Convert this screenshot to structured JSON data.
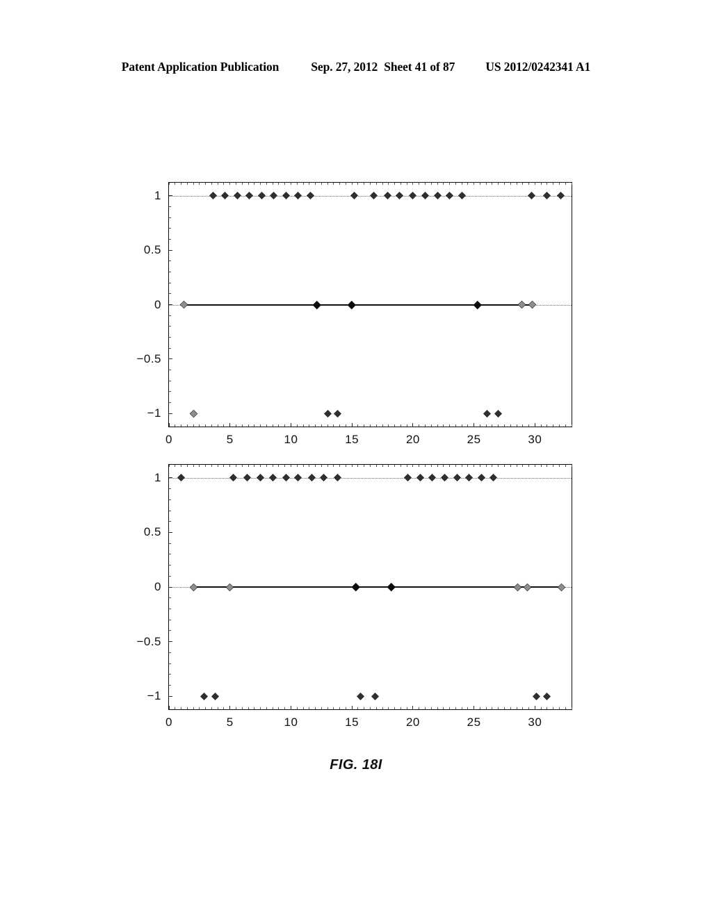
{
  "header": {
    "publication": "Patent Application Publication",
    "date": "Sep. 27, 2012",
    "sheet": "Sheet 41 of 87",
    "patent_number": "US 2012/0242341 A1"
  },
  "figure": {
    "caption": "FIG. 18I"
  },
  "axes": {
    "x_ticks": [
      "0",
      "5",
      "10",
      "15",
      "20",
      "25",
      "30"
    ],
    "y_ticks": [
      "1",
      "0.5",
      "0",
      "−0.5",
      "−1"
    ]
  },
  "colors": {
    "ink": "#0b0b0b",
    "marker": "#2f2f2f",
    "marker_open": "#8e8e8e",
    "grid": "#6b6b6b"
  },
  "chart_data": [
    {
      "type": "scatter",
      "id": "chart-1",
      "title": "",
      "xlabel": "",
      "ylabel": "",
      "xlim": [
        0,
        33
      ],
      "ylim": [
        -1.12,
        1.12
      ],
      "x_ticks": [
        0,
        5,
        10,
        15,
        20,
        25,
        30
      ],
      "y_ticks": [
        1,
        0.5,
        0,
        -0.5,
        -1
      ],
      "grid": true,
      "marker": "diamond",
      "series": [
        {
          "name": "signal-1",
          "points": [
            {
              "x": 1.2,
              "y": 0,
              "style": "open"
            },
            {
              "x": 2.0,
              "y": -1,
              "style": "open"
            },
            {
              "x": 3.6,
              "y": 1,
              "style": "filled"
            },
            {
              "x": 4.6,
              "y": 1,
              "style": "filled"
            },
            {
              "x": 5.6,
              "y": 1,
              "style": "filled"
            },
            {
              "x": 6.6,
              "y": 1,
              "style": "filled"
            },
            {
              "x": 7.6,
              "y": 1,
              "style": "filled"
            },
            {
              "x": 8.6,
              "y": 1,
              "style": "filled"
            },
            {
              "x": 9.6,
              "y": 1,
              "style": "filled"
            },
            {
              "x": 10.6,
              "y": 1,
              "style": "filled"
            },
            {
              "x": 11.6,
              "y": 1,
              "style": "filled"
            },
            {
              "x": 12.1,
              "y": 0,
              "style": "solid"
            },
            {
              "x": 13.0,
              "y": -1,
              "style": "filled"
            },
            {
              "x": 13.8,
              "y": -1,
              "style": "filled"
            },
            {
              "x": 15.0,
              "y": 0,
              "style": "solid"
            },
            {
              "x": 15.2,
              "y": 1,
              "style": "filled"
            },
            {
              "x": 16.8,
              "y": 1,
              "style": "filled"
            },
            {
              "x": 17.9,
              "y": 1,
              "style": "filled"
            },
            {
              "x": 18.9,
              "y": 1,
              "style": "filled"
            },
            {
              "x": 20.0,
              "y": 1,
              "style": "filled"
            },
            {
              "x": 21.0,
              "y": 1,
              "style": "filled"
            },
            {
              "x": 22.0,
              "y": 1,
              "style": "filled"
            },
            {
              "x": 23.0,
              "y": 1,
              "style": "filled"
            },
            {
              "x": 24.0,
              "y": 1,
              "style": "filled"
            },
            {
              "x": 25.3,
              "y": 0,
              "style": "solid"
            },
            {
              "x": 26.1,
              "y": -1,
              "style": "filled"
            },
            {
              "x": 27.0,
              "y": -1,
              "style": "filled"
            },
            {
              "x": 28.9,
              "y": 0,
              "style": "open"
            },
            {
              "x": 29.8,
              "y": 0,
              "style": "open"
            },
            {
              "x": 29.7,
              "y": 1,
              "style": "filled"
            },
            {
              "x": 31.0,
              "y": 1,
              "style": "filled"
            },
            {
              "x": 32.1,
              "y": 1,
              "style": "filled"
            }
          ]
        }
      ],
      "zero_segments": [
        [
          1.2,
          29.8
        ]
      ]
    },
    {
      "type": "scatter",
      "id": "chart-2",
      "title": "",
      "xlabel": "",
      "ylabel": "",
      "xlim": [
        0,
        33
      ],
      "ylim": [
        -1.12,
        1.12
      ],
      "x_ticks": [
        0,
        5,
        10,
        15,
        20,
        25,
        30
      ],
      "y_ticks": [
        1,
        0.5,
        0,
        -0.5,
        -1
      ],
      "grid": true,
      "marker": "diamond",
      "series": [
        {
          "name": "signal-2",
          "points": [
            {
              "x": 1.0,
              "y": 1,
              "style": "filled"
            },
            {
              "x": 2.0,
              "y": 0,
              "style": "open"
            },
            {
              "x": 2.9,
              "y": -1,
              "style": "filled"
            },
            {
              "x": 3.8,
              "y": -1,
              "style": "filled"
            },
            {
              "x": 5.0,
              "y": 0,
              "style": "open"
            },
            {
              "x": 5.3,
              "y": 1,
              "style": "filled"
            },
            {
              "x": 6.4,
              "y": 1,
              "style": "filled"
            },
            {
              "x": 7.5,
              "y": 1,
              "style": "filled"
            },
            {
              "x": 8.5,
              "y": 1,
              "style": "filled"
            },
            {
              "x": 9.6,
              "y": 1,
              "style": "filled"
            },
            {
              "x": 10.6,
              "y": 1,
              "style": "filled"
            },
            {
              "x": 11.7,
              "y": 1,
              "style": "filled"
            },
            {
              "x": 12.7,
              "y": 1,
              "style": "filled"
            },
            {
              "x": 13.8,
              "y": 1,
              "style": "filled"
            },
            {
              "x": 15.3,
              "y": 0,
              "style": "solid"
            },
            {
              "x": 15.7,
              "y": -1,
              "style": "filled"
            },
            {
              "x": 16.9,
              "y": -1,
              "style": "filled"
            },
            {
              "x": 18.2,
              "y": 0,
              "style": "solid"
            },
            {
              "x": 19.6,
              "y": 1,
              "style": "filled"
            },
            {
              "x": 20.6,
              "y": 1,
              "style": "filled"
            },
            {
              "x": 21.6,
              "y": 1,
              "style": "filled"
            },
            {
              "x": 22.6,
              "y": 1,
              "style": "filled"
            },
            {
              "x": 23.6,
              "y": 1,
              "style": "filled"
            },
            {
              "x": 24.6,
              "y": 1,
              "style": "filled"
            },
            {
              "x": 25.6,
              "y": 1,
              "style": "filled"
            },
            {
              "x": 26.6,
              "y": 1,
              "style": "filled"
            },
            {
              "x": 28.6,
              "y": 0,
              "style": "open"
            },
            {
              "x": 29.4,
              "y": 0,
              "style": "open"
            },
            {
              "x": 30.1,
              "y": -1,
              "style": "filled"
            },
            {
              "x": 31.0,
              "y": -1,
              "style": "filled"
            },
            {
              "x": 32.2,
              "y": 0,
              "style": "open"
            }
          ]
        }
      ],
      "zero_segments": [
        [
          2.0,
          32.2
        ]
      ]
    }
  ]
}
